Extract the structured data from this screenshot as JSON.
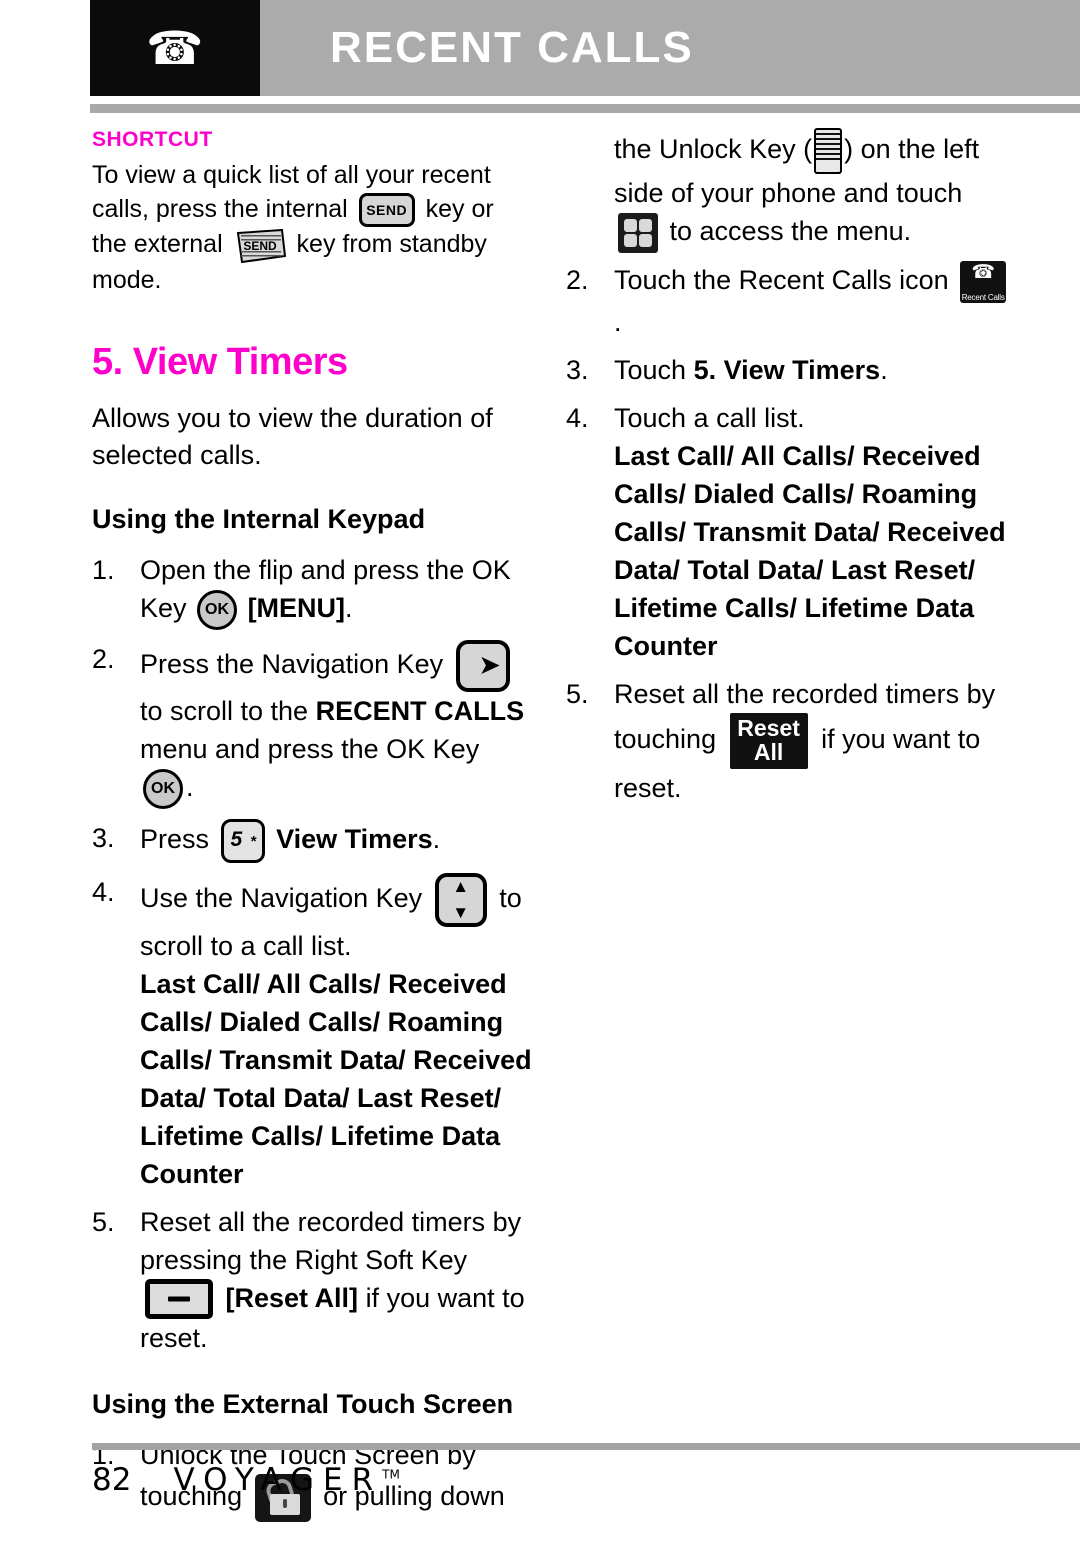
{
  "header": {
    "title": "RECENT CALLS",
    "icon": "recent-calls-phone-icon"
  },
  "shortcut": {
    "label": "SHORTCUT",
    "text_part1": "To view a quick list of all your recent calls, press the internal",
    "key_internal": "SEND",
    "text_part2": "key or the external",
    "key_external": "SEND",
    "text_part3": "key from standby mode."
  },
  "section": {
    "title": "5. View Timers",
    "intro": "Allows you to view the duration of selected calls."
  },
  "internal_keypad": {
    "heading": "Using the Internal Keypad",
    "steps": [
      {
        "num": "1.",
        "text_a": "Open the flip and press the OK Key",
        "icon": "OK",
        "text_b": "[MENU]",
        "text_c": "."
      },
      {
        "num": "2.",
        "text_a": "Press the Navigation Key",
        "icon": "nav-right-key",
        "text_b": "to scroll to the",
        "bold": "RECENT CALLS",
        "text_c": "menu and press the OK Key",
        "icon2": "OK",
        "text_d": "."
      },
      {
        "num": "3.",
        "text_a": "Press",
        "icon": "key-5",
        "bold": "View Timers",
        "text_b": "."
      },
      {
        "num": "4.",
        "text_a": "Use the Navigation Key",
        "icon": "nav-up-down-key",
        "text_b": "to scroll to a call list.",
        "call_list": "Last Call/ All Calls/ Received Calls/ Dialed Calls/ Roaming Calls/ Transmit Data/ Received Data/ Total Data/ Last Reset/ Lifetime Calls/ Lifetime Data Counter"
      },
      {
        "num": "5.",
        "text_a": "Reset all the recorded timers by pressing the Right Soft Key",
        "icon": "right-soft-key",
        "bold": "[Reset All]",
        "text_b": "if you want to reset."
      }
    ]
  },
  "external_touch": {
    "heading": "Using the External Touch Screen",
    "steps": [
      {
        "num": "1.",
        "text_a": "Unlock the Touch Screen by touching",
        "icon": "lock-tile-icon",
        "text_b": "or pulling down"
      }
    ]
  },
  "right_column": {
    "continued": {
      "text_a": "the Unlock Key (",
      "icon_unlock": "unlock-key-icon",
      "text_b": ") on the left side of your phone and touch",
      "icon_menu": "menu-grid-icon",
      "text_c": "to access the menu."
    },
    "steps": [
      {
        "num": "2.",
        "text_a": "Touch the Recent Calls icon",
        "icon": "recent-calls-tile-icon",
        "text_b": "."
      },
      {
        "num": "3.",
        "text_a": "Touch",
        "bold": "5. View Timers",
        "text_b": "."
      },
      {
        "num": "4.",
        "text_a": "Touch a call list.",
        "call_list": "Last Call/ All Calls/ Received Calls/ Dialed Calls/ Roaming Calls/ Transmit Data/ Received Data/ Total Data/ Last Reset/ Lifetime Calls/ Lifetime Data Counter"
      },
      {
        "num": "5.",
        "text_a": "Reset all the recorded timers by touching",
        "icon_l1": "Reset",
        "icon_l2": "All",
        "text_b": "if you want to reset."
      }
    ]
  },
  "footer": {
    "page": "82",
    "brand": "VOYAGER",
    "tm": "TM"
  },
  "colors": {
    "magenta": "#ff00cc",
    "header_gray": "#ababab",
    "header_icon_bg": "#0b0b0b",
    "text": "#000000"
  }
}
